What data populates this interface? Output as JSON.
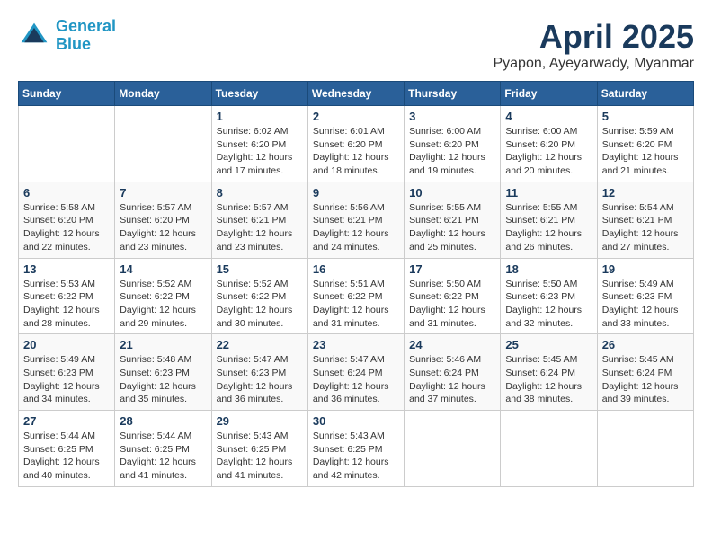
{
  "header": {
    "logo_line1": "General",
    "logo_line2": "Blue",
    "month_title": "April 2025",
    "location": "Pyapon, Ayeyarwady, Myanmar"
  },
  "days_of_week": [
    "Sunday",
    "Monday",
    "Tuesday",
    "Wednesday",
    "Thursday",
    "Friday",
    "Saturday"
  ],
  "weeks": [
    [
      {
        "day": "",
        "sunrise": "",
        "sunset": "",
        "daylight": ""
      },
      {
        "day": "",
        "sunrise": "",
        "sunset": "",
        "daylight": ""
      },
      {
        "day": "1",
        "sunrise": "Sunrise: 6:02 AM",
        "sunset": "Sunset: 6:20 PM",
        "daylight": "Daylight: 12 hours and 17 minutes."
      },
      {
        "day": "2",
        "sunrise": "Sunrise: 6:01 AM",
        "sunset": "Sunset: 6:20 PM",
        "daylight": "Daylight: 12 hours and 18 minutes."
      },
      {
        "day": "3",
        "sunrise": "Sunrise: 6:00 AM",
        "sunset": "Sunset: 6:20 PM",
        "daylight": "Daylight: 12 hours and 19 minutes."
      },
      {
        "day": "4",
        "sunrise": "Sunrise: 6:00 AM",
        "sunset": "Sunset: 6:20 PM",
        "daylight": "Daylight: 12 hours and 20 minutes."
      },
      {
        "day": "5",
        "sunrise": "Sunrise: 5:59 AM",
        "sunset": "Sunset: 6:20 PM",
        "daylight": "Daylight: 12 hours and 21 minutes."
      }
    ],
    [
      {
        "day": "6",
        "sunrise": "Sunrise: 5:58 AM",
        "sunset": "Sunset: 6:20 PM",
        "daylight": "Daylight: 12 hours and 22 minutes."
      },
      {
        "day": "7",
        "sunrise": "Sunrise: 5:57 AM",
        "sunset": "Sunset: 6:20 PM",
        "daylight": "Daylight: 12 hours and 23 minutes."
      },
      {
        "day": "8",
        "sunrise": "Sunrise: 5:57 AM",
        "sunset": "Sunset: 6:21 PM",
        "daylight": "Daylight: 12 hours and 23 minutes."
      },
      {
        "day": "9",
        "sunrise": "Sunrise: 5:56 AM",
        "sunset": "Sunset: 6:21 PM",
        "daylight": "Daylight: 12 hours and 24 minutes."
      },
      {
        "day": "10",
        "sunrise": "Sunrise: 5:55 AM",
        "sunset": "Sunset: 6:21 PM",
        "daylight": "Daylight: 12 hours and 25 minutes."
      },
      {
        "day": "11",
        "sunrise": "Sunrise: 5:55 AM",
        "sunset": "Sunset: 6:21 PM",
        "daylight": "Daylight: 12 hours and 26 minutes."
      },
      {
        "day": "12",
        "sunrise": "Sunrise: 5:54 AM",
        "sunset": "Sunset: 6:21 PM",
        "daylight": "Daylight: 12 hours and 27 minutes."
      }
    ],
    [
      {
        "day": "13",
        "sunrise": "Sunrise: 5:53 AM",
        "sunset": "Sunset: 6:22 PM",
        "daylight": "Daylight: 12 hours and 28 minutes."
      },
      {
        "day": "14",
        "sunrise": "Sunrise: 5:52 AM",
        "sunset": "Sunset: 6:22 PM",
        "daylight": "Daylight: 12 hours and 29 minutes."
      },
      {
        "day": "15",
        "sunrise": "Sunrise: 5:52 AM",
        "sunset": "Sunset: 6:22 PM",
        "daylight": "Daylight: 12 hours and 30 minutes."
      },
      {
        "day": "16",
        "sunrise": "Sunrise: 5:51 AM",
        "sunset": "Sunset: 6:22 PM",
        "daylight": "Daylight: 12 hours and 31 minutes."
      },
      {
        "day": "17",
        "sunrise": "Sunrise: 5:50 AM",
        "sunset": "Sunset: 6:22 PM",
        "daylight": "Daylight: 12 hours and 31 minutes."
      },
      {
        "day": "18",
        "sunrise": "Sunrise: 5:50 AM",
        "sunset": "Sunset: 6:23 PM",
        "daylight": "Daylight: 12 hours and 32 minutes."
      },
      {
        "day": "19",
        "sunrise": "Sunrise: 5:49 AM",
        "sunset": "Sunset: 6:23 PM",
        "daylight": "Daylight: 12 hours and 33 minutes."
      }
    ],
    [
      {
        "day": "20",
        "sunrise": "Sunrise: 5:49 AM",
        "sunset": "Sunset: 6:23 PM",
        "daylight": "Daylight: 12 hours and 34 minutes."
      },
      {
        "day": "21",
        "sunrise": "Sunrise: 5:48 AM",
        "sunset": "Sunset: 6:23 PM",
        "daylight": "Daylight: 12 hours and 35 minutes."
      },
      {
        "day": "22",
        "sunrise": "Sunrise: 5:47 AM",
        "sunset": "Sunset: 6:23 PM",
        "daylight": "Daylight: 12 hours and 36 minutes."
      },
      {
        "day": "23",
        "sunrise": "Sunrise: 5:47 AM",
        "sunset": "Sunset: 6:24 PM",
        "daylight": "Daylight: 12 hours and 36 minutes."
      },
      {
        "day": "24",
        "sunrise": "Sunrise: 5:46 AM",
        "sunset": "Sunset: 6:24 PM",
        "daylight": "Daylight: 12 hours and 37 minutes."
      },
      {
        "day": "25",
        "sunrise": "Sunrise: 5:45 AM",
        "sunset": "Sunset: 6:24 PM",
        "daylight": "Daylight: 12 hours and 38 minutes."
      },
      {
        "day": "26",
        "sunrise": "Sunrise: 5:45 AM",
        "sunset": "Sunset: 6:24 PM",
        "daylight": "Daylight: 12 hours and 39 minutes."
      }
    ],
    [
      {
        "day": "27",
        "sunrise": "Sunrise: 5:44 AM",
        "sunset": "Sunset: 6:25 PM",
        "daylight": "Daylight: 12 hours and 40 minutes."
      },
      {
        "day": "28",
        "sunrise": "Sunrise: 5:44 AM",
        "sunset": "Sunset: 6:25 PM",
        "daylight": "Daylight: 12 hours and 41 minutes."
      },
      {
        "day": "29",
        "sunrise": "Sunrise: 5:43 AM",
        "sunset": "Sunset: 6:25 PM",
        "daylight": "Daylight: 12 hours and 41 minutes."
      },
      {
        "day": "30",
        "sunrise": "Sunrise: 5:43 AM",
        "sunset": "Sunset: 6:25 PM",
        "daylight": "Daylight: 12 hours and 42 minutes."
      },
      {
        "day": "",
        "sunrise": "",
        "sunset": "",
        "daylight": ""
      },
      {
        "day": "",
        "sunrise": "",
        "sunset": "",
        "daylight": ""
      },
      {
        "day": "",
        "sunrise": "",
        "sunset": "",
        "daylight": ""
      }
    ]
  ]
}
